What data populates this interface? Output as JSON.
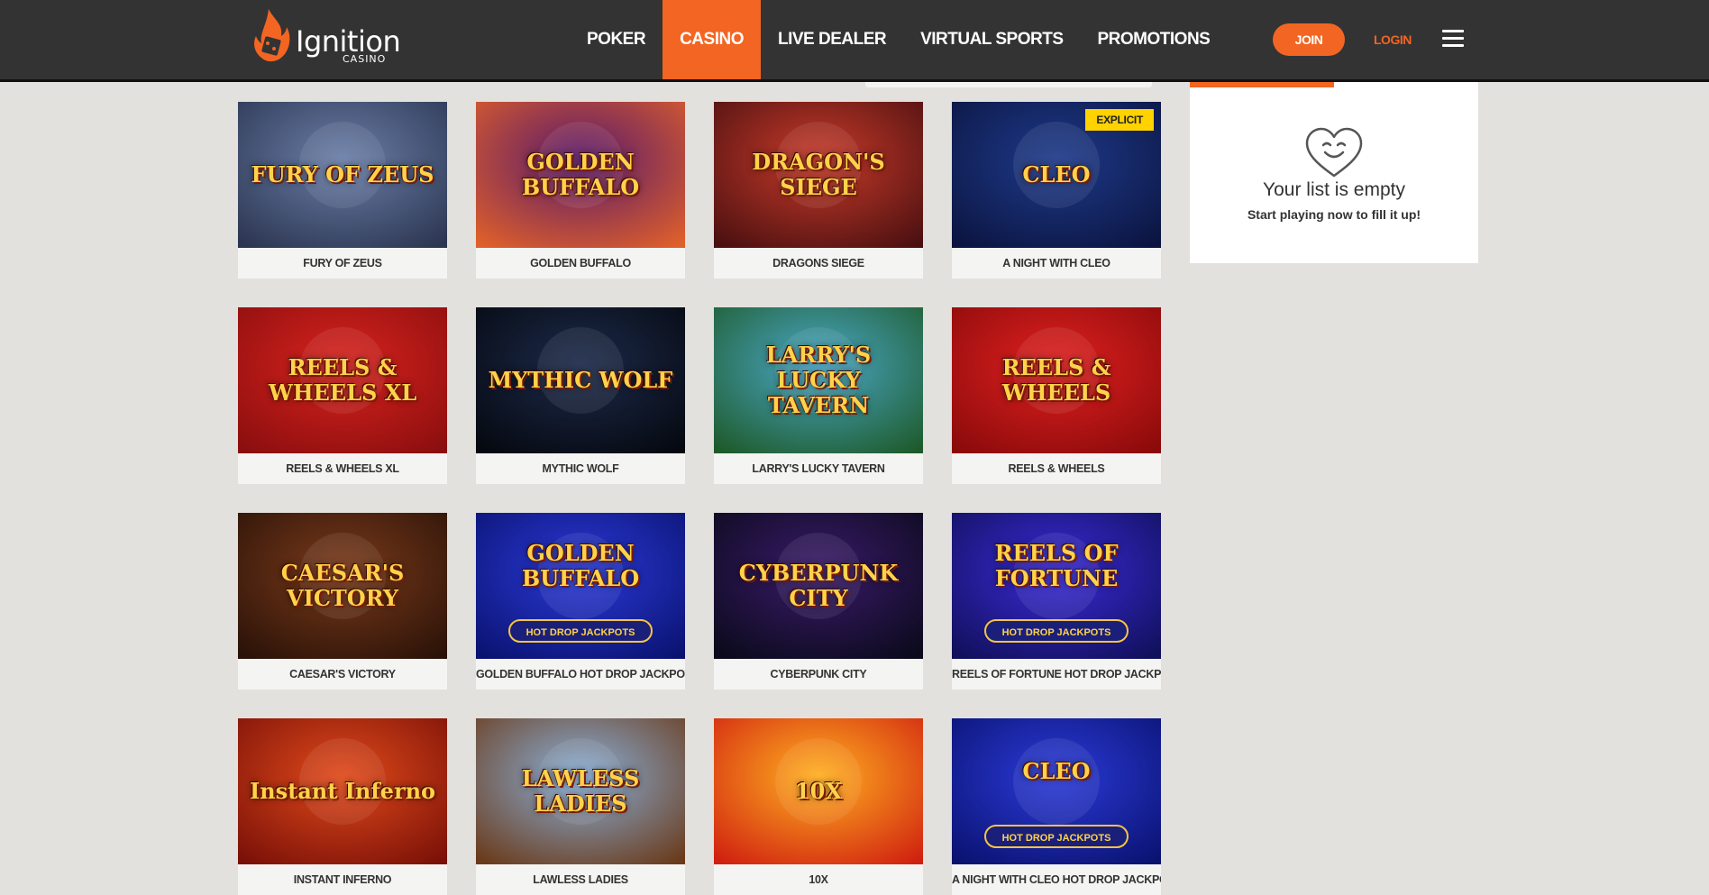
{
  "brand": {
    "name": "Ignition",
    "sub": "CASINO"
  },
  "nav": [
    {
      "label": "POKER",
      "active": false
    },
    {
      "label": "CASINO",
      "active": true
    },
    {
      "label": "LIVE DEALER",
      "active": false
    },
    {
      "label": "VIRTUAL SPORTS",
      "active": false
    },
    {
      "label": "PROMOTIONS",
      "active": false
    }
  ],
  "header": {
    "join_label": "JOIN",
    "login_label": "LOGIN"
  },
  "favorites": {
    "title": "Your list is empty",
    "subtitle": "Start playing now to fill it up!"
  },
  "colors": {
    "accent": "#f26522",
    "header_bg": "#333333",
    "page_bg": "#e2e1dd",
    "badge": "#ffd200"
  },
  "games": [
    {
      "title": "FURY OF ZEUS",
      "art": "FURY OF ZEUS",
      "bg": [
        "#6a7ea8",
        "#2b3550"
      ]
    },
    {
      "title": "GOLDEN BUFFALO",
      "art": "GOLDEN BUFFALO",
      "bg": [
        "#5a1a6a",
        "#e0602a"
      ]
    },
    {
      "title": "DRAGONS SIEGE",
      "art": "DRAGON'S SIEGE",
      "bg": [
        "#c83a2a",
        "#4a1010"
      ]
    },
    {
      "title": "A NIGHT WITH CLEO",
      "art": "CLEO",
      "bg": [
        "#1e3a8a",
        "#0b1440"
      ],
      "badge": "EXPLICIT"
    },
    {
      "title": "REELS & WHEELS XL",
      "art": "REELS & WHEELS XL",
      "bg": [
        "#d8231e",
        "#8a0e0e"
      ]
    },
    {
      "title": "MYTHIC WOLF",
      "art": "MYTHIC WOLF",
      "bg": [
        "#1c2a4a",
        "#05080f"
      ]
    },
    {
      "title": "LARRY'S LUCKY TAVERN",
      "art": "LARRY'S LUCKY TAVERN",
      "bg": [
        "#4aa8c8",
        "#1e5a2a"
      ]
    },
    {
      "title": "REELS & WHEELS",
      "art": "REELS & WHEELS",
      "bg": [
        "#e02020",
        "#8a0a0a"
      ]
    },
    {
      "title": "CAESAR'S VICTORY",
      "art": "CAESAR'S VICTORY",
      "bg": [
        "#7a3a1a",
        "#2a1208"
      ]
    },
    {
      "title": "GOLDEN BUFFALO HOT DROP JACKPOTS",
      "art": "GOLDEN BUFFALO",
      "bg": [
        "#2a3ad8",
        "#0a1270"
      ],
      "jackpot": "HOT DROP JACKPOTS"
    },
    {
      "title": "CYBERPUNK CITY",
      "art": "CYBERPUNK CITY",
      "bg": [
        "#3a1a6a",
        "#0a0a1a"
      ]
    },
    {
      "title": "REELS OF FORTUNE HOT DROP JACKPOTS",
      "art": "REELS OF FORTUNE",
      "bg": [
        "#3a2ad8",
        "#10105a"
      ],
      "jackpot": "HOT DROP JACKPOTS"
    },
    {
      "title": "INSTANT INFERNO",
      "art": "Instant Inferno",
      "bg": [
        "#e04a1a",
        "#7a1008"
      ]
    },
    {
      "title": "LAWLESS LADIES",
      "art": "LAWLESS LADIES",
      "bg": [
        "#8ab0d8",
        "#6a3a1a"
      ]
    },
    {
      "title": "10X",
      "art": "10X",
      "bg": [
        "#ffb020",
        "#d02010"
      ]
    },
    {
      "title": "A NIGHT WITH CLEO HOT DROP JACKPOTS",
      "art": "CLEO",
      "bg": [
        "#2a3ad8",
        "#0a1270"
      ],
      "jackpot": "HOT DROP JACKPOTS"
    }
  ]
}
